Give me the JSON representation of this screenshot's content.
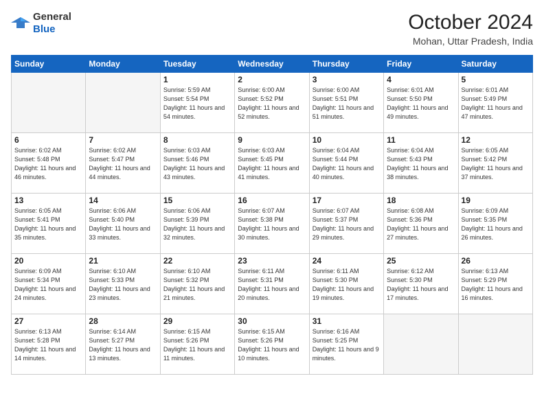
{
  "header": {
    "logo_general": "General",
    "logo_blue": "Blue",
    "month_year": "October 2024",
    "location": "Mohan, Uttar Pradesh, India"
  },
  "weekdays": [
    "Sunday",
    "Monday",
    "Tuesday",
    "Wednesday",
    "Thursday",
    "Friday",
    "Saturday"
  ],
  "weeks": [
    [
      {
        "day": "",
        "info": ""
      },
      {
        "day": "",
        "info": ""
      },
      {
        "day": "1",
        "info": "Sunrise: 5:59 AM\nSunset: 5:54 PM\nDaylight: 11 hours and 54 minutes."
      },
      {
        "day": "2",
        "info": "Sunrise: 6:00 AM\nSunset: 5:52 PM\nDaylight: 11 hours and 52 minutes."
      },
      {
        "day": "3",
        "info": "Sunrise: 6:00 AM\nSunset: 5:51 PM\nDaylight: 11 hours and 51 minutes."
      },
      {
        "day": "4",
        "info": "Sunrise: 6:01 AM\nSunset: 5:50 PM\nDaylight: 11 hours and 49 minutes."
      },
      {
        "day": "5",
        "info": "Sunrise: 6:01 AM\nSunset: 5:49 PM\nDaylight: 11 hours and 47 minutes."
      }
    ],
    [
      {
        "day": "6",
        "info": "Sunrise: 6:02 AM\nSunset: 5:48 PM\nDaylight: 11 hours and 46 minutes."
      },
      {
        "day": "7",
        "info": "Sunrise: 6:02 AM\nSunset: 5:47 PM\nDaylight: 11 hours and 44 minutes."
      },
      {
        "day": "8",
        "info": "Sunrise: 6:03 AM\nSunset: 5:46 PM\nDaylight: 11 hours and 43 minutes."
      },
      {
        "day": "9",
        "info": "Sunrise: 6:03 AM\nSunset: 5:45 PM\nDaylight: 11 hours and 41 minutes."
      },
      {
        "day": "10",
        "info": "Sunrise: 6:04 AM\nSunset: 5:44 PM\nDaylight: 11 hours and 40 minutes."
      },
      {
        "day": "11",
        "info": "Sunrise: 6:04 AM\nSunset: 5:43 PM\nDaylight: 11 hours and 38 minutes."
      },
      {
        "day": "12",
        "info": "Sunrise: 6:05 AM\nSunset: 5:42 PM\nDaylight: 11 hours and 37 minutes."
      }
    ],
    [
      {
        "day": "13",
        "info": "Sunrise: 6:05 AM\nSunset: 5:41 PM\nDaylight: 11 hours and 35 minutes."
      },
      {
        "day": "14",
        "info": "Sunrise: 6:06 AM\nSunset: 5:40 PM\nDaylight: 11 hours and 33 minutes."
      },
      {
        "day": "15",
        "info": "Sunrise: 6:06 AM\nSunset: 5:39 PM\nDaylight: 11 hours and 32 minutes."
      },
      {
        "day": "16",
        "info": "Sunrise: 6:07 AM\nSunset: 5:38 PM\nDaylight: 11 hours and 30 minutes."
      },
      {
        "day": "17",
        "info": "Sunrise: 6:07 AM\nSunset: 5:37 PM\nDaylight: 11 hours and 29 minutes."
      },
      {
        "day": "18",
        "info": "Sunrise: 6:08 AM\nSunset: 5:36 PM\nDaylight: 11 hours and 27 minutes."
      },
      {
        "day": "19",
        "info": "Sunrise: 6:09 AM\nSunset: 5:35 PM\nDaylight: 11 hours and 26 minutes."
      }
    ],
    [
      {
        "day": "20",
        "info": "Sunrise: 6:09 AM\nSunset: 5:34 PM\nDaylight: 11 hours and 24 minutes."
      },
      {
        "day": "21",
        "info": "Sunrise: 6:10 AM\nSunset: 5:33 PM\nDaylight: 11 hours and 23 minutes."
      },
      {
        "day": "22",
        "info": "Sunrise: 6:10 AM\nSunset: 5:32 PM\nDaylight: 11 hours and 21 minutes."
      },
      {
        "day": "23",
        "info": "Sunrise: 6:11 AM\nSunset: 5:31 PM\nDaylight: 11 hours and 20 minutes."
      },
      {
        "day": "24",
        "info": "Sunrise: 6:11 AM\nSunset: 5:30 PM\nDaylight: 11 hours and 19 minutes."
      },
      {
        "day": "25",
        "info": "Sunrise: 6:12 AM\nSunset: 5:30 PM\nDaylight: 11 hours and 17 minutes."
      },
      {
        "day": "26",
        "info": "Sunrise: 6:13 AM\nSunset: 5:29 PM\nDaylight: 11 hours and 16 minutes."
      }
    ],
    [
      {
        "day": "27",
        "info": "Sunrise: 6:13 AM\nSunset: 5:28 PM\nDaylight: 11 hours and 14 minutes."
      },
      {
        "day": "28",
        "info": "Sunrise: 6:14 AM\nSunset: 5:27 PM\nDaylight: 11 hours and 13 minutes."
      },
      {
        "day": "29",
        "info": "Sunrise: 6:15 AM\nSunset: 5:26 PM\nDaylight: 11 hours and 11 minutes."
      },
      {
        "day": "30",
        "info": "Sunrise: 6:15 AM\nSunset: 5:26 PM\nDaylight: 11 hours and 10 minutes."
      },
      {
        "day": "31",
        "info": "Sunrise: 6:16 AM\nSunset: 5:25 PM\nDaylight: 11 hours and 9 minutes."
      },
      {
        "day": "",
        "info": ""
      },
      {
        "day": "",
        "info": ""
      }
    ]
  ]
}
